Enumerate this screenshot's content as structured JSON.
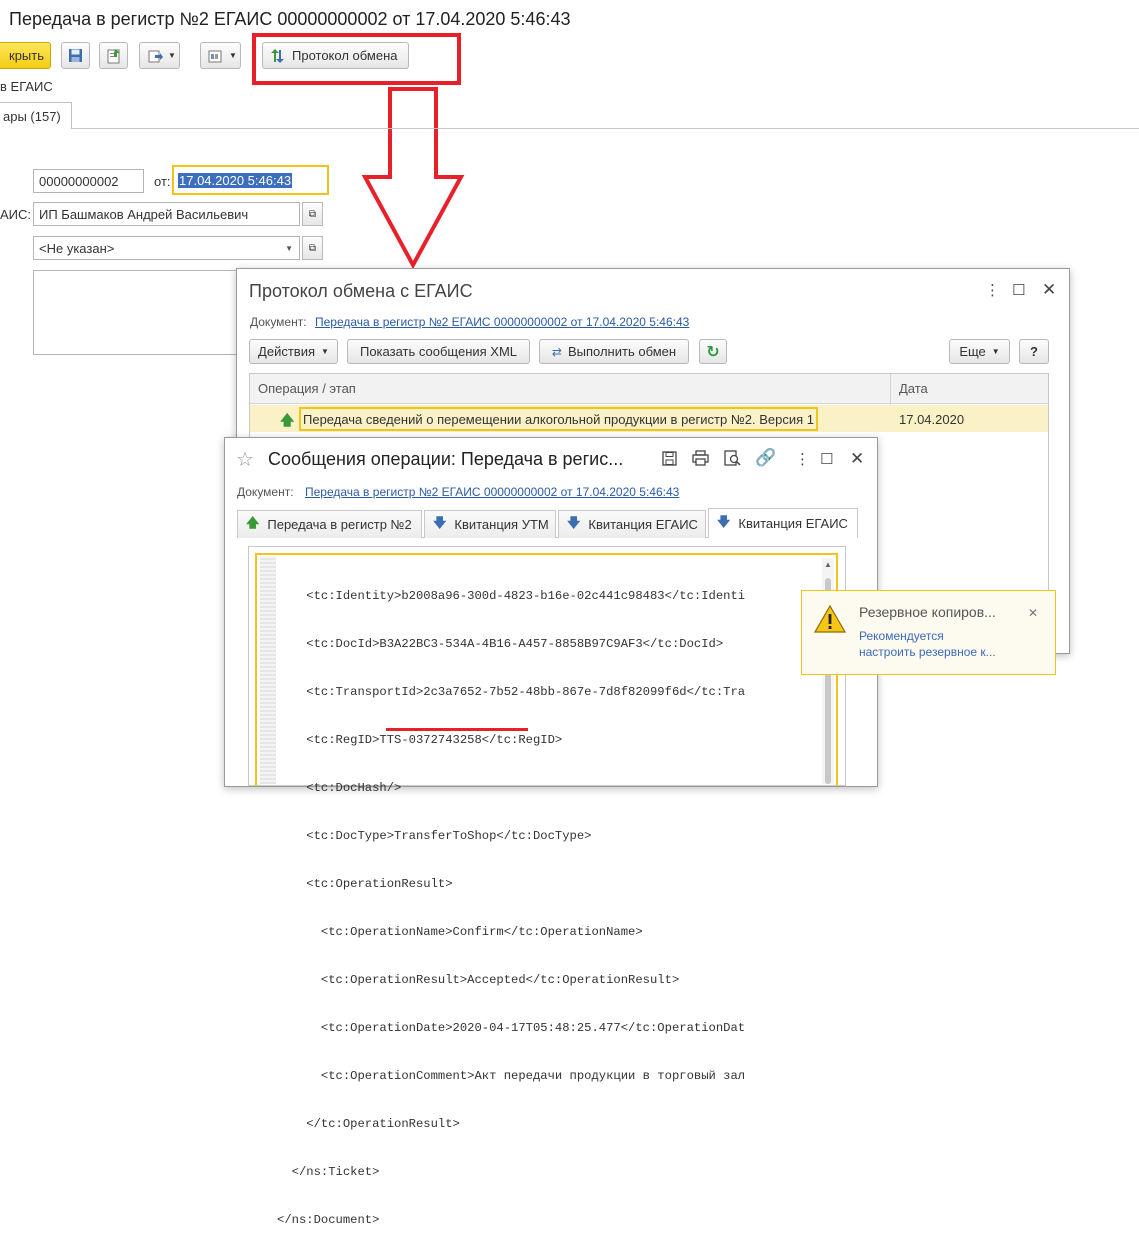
{
  "main": {
    "title": "Передача в регистр №2 ЕГАИС 00000000002 от 17.04.2020 5:46:43",
    "post_close_label": "крыть",
    "egais_link": "в ЕГАИС",
    "tab_goods": "ары (157)",
    "protocol_button": "Протокол обмена",
    "number_value": "00000000002",
    "date_label": "от:",
    "date_value": "17.04.2020  5:46:43",
    "org_label": "АИС:",
    "org_value": "ИП Башмаков Андрей Васильевич",
    "second_value": "<Не указан>"
  },
  "protocol": {
    "title": "Протокол обмена с ЕГАИС",
    "doc_label": "Документ:",
    "doc_link": "Передача в регистр №2 ЕГАИС 00000000002 от 17.04.2020 5:46:43",
    "actions_button": "Действия",
    "show_xml_button": "Показать сообщения XML",
    "exchange_button": "Выполнить обмен",
    "more_button": "Еще",
    "help_button": "?",
    "columns": [
      "Операция / этап",
      "Дата"
    ],
    "row": {
      "operation": "Передача сведений о перемещении алкогольной продукции в регистр №2. Версия 1",
      "date": "17.04.2020"
    }
  },
  "messages": {
    "title": "Сообщения операции: Передача в регис...",
    "doc_label": "Документ:",
    "doc_link": "Передача в регистр №2 ЕГАИС 00000000002 от 17.04.2020 5:46:43",
    "tabs": [
      "Передача в регистр №2",
      "Квитанция УТМ",
      "Квитанция ЕГАИС",
      "Квитанция ЕГАИС"
    ],
    "xml_lines": [
      "    <tc:Identity>b2008a96-300d-4823-b16e-02c441c98483</tc:Identi",
      "    <tc:DocId>B3A22BC3-534A-4B16-A457-8858B97C9AF3</tc:DocId>",
      "    <tc:TransportId>2c3a7652-7b52-48bb-867e-7d8f82099f6d</tc:Tra",
      "    <tc:RegID>TTS-0372743258</tc:RegID>",
      "    <tc:DocHash/>",
      "    <tc:DocType>TransferToShop</tc:DocType>",
      "    <tc:OperationResult>",
      "      <tc:OperationName>Confirm</tc:OperationName>",
      "      <tc:OperationResult>Accepted</tc:OperationResult>",
      "      <tc:OperationDate>2020-04-17T05:48:25.477</tc:OperationDat",
      "      <tc:OperationComment>Акт передачи продукции в торговый зал",
      "    </tc:OperationResult>",
      "  </ns:Ticket>",
      "</ns:Document>"
    ]
  },
  "notification": {
    "title": "Резервное копиров...",
    "line1": "Рекомендуется",
    "line2": "настроить резервное к..."
  },
  "colors": {
    "highlight": "#f0c419",
    "annotation": "#e8202a",
    "link": "#2a5aa8",
    "accent_yellow": "#fbe046"
  }
}
